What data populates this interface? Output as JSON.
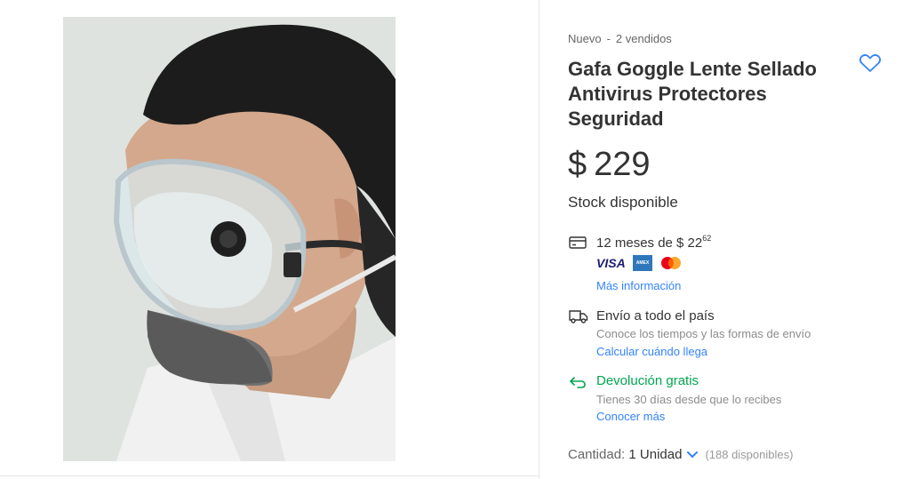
{
  "product": {
    "condition": "Nuevo",
    "separator": "-",
    "sold": "2 vendidos",
    "title": "Gafa Goggle Lente Sellado Antivirus Protectores Seguridad",
    "currency": "$",
    "price": "229",
    "stock": "Stock disponible"
  },
  "payment": {
    "icon": "credit-card-icon",
    "installments_prefix": "12 meses de $ 22",
    "installments_cents": "62",
    "brand_visa": "VISA",
    "more_info": "Más información"
  },
  "shipping": {
    "icon": "truck-icon",
    "title": "Envío a todo el país",
    "detail": "Conoce los tiempos y las formas de envío",
    "link": "Calcular cuándo llega"
  },
  "returns": {
    "icon": "return-arrow-icon",
    "title": "Devolución gratis",
    "detail": "Tienes 30 días desde que lo recibes",
    "link": "Conocer más"
  },
  "quantity": {
    "label": "Cantidad:",
    "value": "1 Unidad",
    "available": "(188 disponibles)"
  },
  "colors": {
    "link": "#3483fa",
    "success": "#00a650",
    "text": "#333333",
    "muted": "#8c8c8c"
  }
}
